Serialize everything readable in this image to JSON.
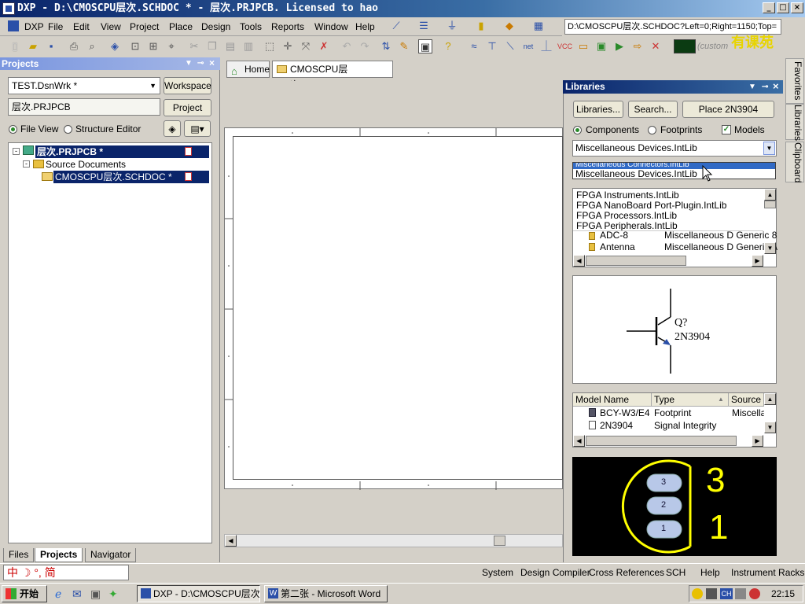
{
  "window": {
    "title": "DXP - D:\\CMOSCPU层次.SCHDOC * - 层次.PRJPCB. Licensed to hao",
    "minimize": "_",
    "maximize": "□",
    "close": "×"
  },
  "menubar": {
    "items": [
      "DXP",
      "File",
      "Edit",
      "View",
      "Project",
      "Place",
      "Design",
      "Tools",
      "Reports",
      "Window",
      "Help"
    ],
    "path": "D:\\CMOSCPU层次.SCHDOC?Left=0;Right=1150;Top="
  },
  "toolbar": {
    "custom_label": "(custom",
    "watermark": "有课苑",
    "color": "#0b3b12"
  },
  "projects": {
    "title": "Projects",
    "workspace_combo": "TEST.DsnWrk *",
    "workspace_button": "Workspace",
    "project_field": "层次.PRJPCB",
    "project_button": "Project",
    "file_view": "File View",
    "structure_editor": "Structure Editor",
    "tree": {
      "root": "层次.PRJPCB *",
      "folder": "Source Documents",
      "doc": "CMOSCPU层次.SCHDOC *"
    },
    "tabs": [
      "Files",
      "Projects",
      "Navigator"
    ]
  },
  "doc_tabs": {
    "home": "Home",
    "schdoc": "CMOSCPU层次.SCHDOC *"
  },
  "libraries": {
    "title": "Libraries",
    "buttons": {
      "libraries": "Libraries...",
      "search": "Search...",
      "place": "Place 2N3904"
    },
    "filters": {
      "components": "Components",
      "footprints": "Footprints",
      "models": "Models"
    },
    "current_lib": "Miscellaneous Devices.IntLib",
    "dropdown_options": [
      "Miscellaneous Connectors.IntLib",
      "Miscellaneous Devices.IntLib"
    ],
    "lib_list": [
      "FPGA Instruments.IntLib",
      "FPGA NanoBoard Port-Plugin.IntLib",
      "FPGA Processors.IntLib",
      "FPGA Peripherals.IntLib"
    ],
    "components": [
      {
        "name": "ADC-8",
        "desc": "Miscellaneous D Generic 8"
      },
      {
        "name": "Antenna",
        "desc": "Miscellaneous D Generic A"
      }
    ],
    "symbol": {
      "designator": "Q?",
      "part": "2N3904"
    },
    "model_table": {
      "headers": [
        "Model Name",
        "Type",
        "Source"
      ],
      "rows": [
        {
          "name": "BCY-W3/E4",
          "type": "Footprint",
          "source": "Miscellan"
        },
        {
          "name": "2N3904",
          "type": "Signal Integrity",
          "source": ""
        }
      ]
    },
    "footprint": {
      "pads": [
        "3",
        "2",
        "1"
      ],
      "big_labels": [
        "3",
        "1"
      ],
      "color": "#ffff00"
    }
  },
  "side_tabs": [
    "Favorites",
    "Libraries",
    "Clipboard"
  ],
  "statusbar": {
    "items": [
      "System",
      "Design Compiler",
      "Cross References",
      "SCH",
      "Help",
      "Instrument Racks"
    ],
    "ime": "中 ☽ °, 简"
  },
  "taskbar": {
    "start": "开始",
    "tasks": [
      "DXP - D:\\CMOSCPU层次....",
      "第二张 - Microsoft Word"
    ],
    "clock": "22:15",
    "tray_ch": "CH"
  }
}
